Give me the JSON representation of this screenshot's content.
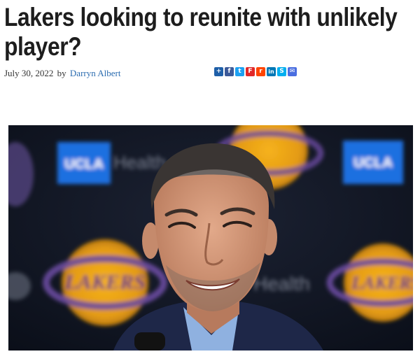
{
  "article": {
    "title": "Lakers looking to reunite with unlikely player?",
    "date": "July 30, 2022",
    "by": "by",
    "author": "Darryn Albert"
  },
  "share": [
    {
      "name": "share-plus-icon",
      "glyph": "+",
      "color": "#1e5fa8"
    },
    {
      "name": "facebook-icon",
      "glyph": "f",
      "color": "#3b5998"
    },
    {
      "name": "twitter-icon",
      "glyph": "t",
      "color": "#1da1f2"
    },
    {
      "name": "flipboard-icon",
      "glyph": "F",
      "color": "#e12828"
    },
    {
      "name": "reddit-icon",
      "glyph": "r",
      "color": "#ff4500"
    },
    {
      "name": "linkedin-icon",
      "glyph": "in",
      "color": "#0077b5"
    },
    {
      "name": "skype-icon",
      "glyph": "S",
      "color": "#00aff0"
    },
    {
      "name": "email-icon",
      "glyph": "✉",
      "color": "#4a6ee0"
    }
  ],
  "photo": {
    "backdrop_text": [
      "UCLA",
      "Health",
      "LAKERS"
    ]
  }
}
